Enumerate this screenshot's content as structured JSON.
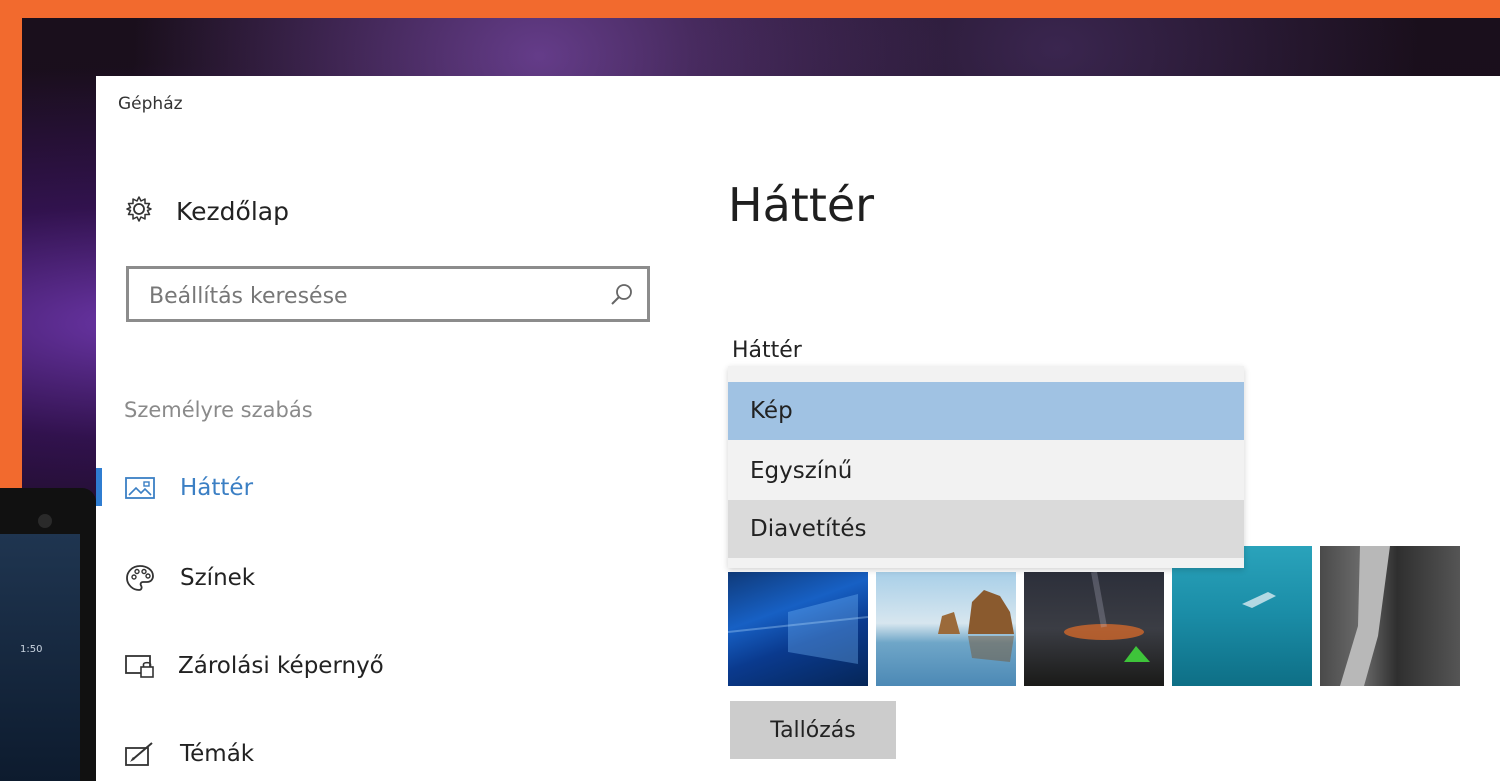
{
  "window": {
    "title": "Gépház"
  },
  "sidebar": {
    "home_label": "Kezdőlap",
    "search_placeholder": "Beállítás keresése",
    "section_label": "Személyre szabás",
    "items": [
      {
        "label": "Háttér",
        "icon": "picture-icon",
        "selected": true
      },
      {
        "label": "Színek",
        "icon": "palette-icon",
        "selected": false
      },
      {
        "label": "Zárolási képernyő",
        "icon": "lock-screen-icon",
        "selected": false
      },
      {
        "label": "Témák",
        "icon": "themes-icon",
        "selected": false
      }
    ]
  },
  "main": {
    "page_title": "Háttér",
    "background_field_label": "Háttér",
    "background_options": [
      "Kép",
      "Egyszínű",
      "Diavetítés"
    ],
    "selected_option": "Kép",
    "recent_pictures": [
      "windows-hero-wallpaper",
      "beach-rocks-wallpaper",
      "night-tent-wallpaper",
      "underwater-wallpaper",
      "rock-cliff-wallpaper"
    ],
    "browse_label": "Tallózás"
  },
  "phone": {
    "time": "1:50"
  },
  "colors": {
    "frame": "#f26a2e",
    "accent": "#2f7dd1",
    "selected_option_bg": "#a0c2e3"
  }
}
